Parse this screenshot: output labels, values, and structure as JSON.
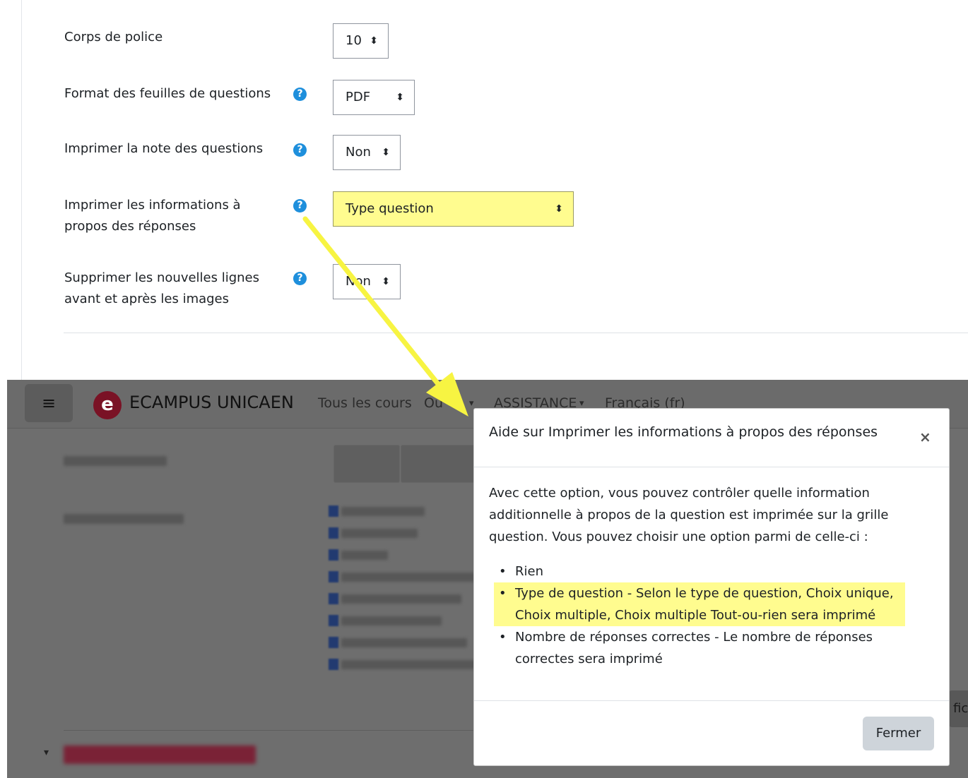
{
  "form": {
    "rows": [
      {
        "label": "Corps de police",
        "has_help": false,
        "value": "10"
      },
      {
        "label": "Format des feuilles de questions",
        "has_help": true,
        "value": "PDF"
      },
      {
        "label": "Imprimer la note des questions",
        "has_help": true,
        "value": "Non"
      },
      {
        "label_line1": "Imprimer les informations à",
        "label_line2": "propos des réponses",
        "has_help": true,
        "value": "Type question",
        "highlighted": true
      },
      {
        "label_line1": "Supprimer les nouvelles lignes",
        "label_line2": "avant et après les images",
        "has_help": true,
        "value": "Non"
      }
    ],
    "help_icon": "?"
  },
  "screenshot": {
    "menu_icon": "≡",
    "logo_letter": "e",
    "brand": "ECAMPUS UNICAEN",
    "nav": [
      "Tous les cours",
      "Ou",
      "ASSISTANCE",
      "Français (fr)"
    ],
    "nav_caret": "▾",
    "partial_button": "fich"
  },
  "modal": {
    "title": "Aide sur Imprimer les informations à propos des réponses",
    "close": "×",
    "intro_line1": "Avec cette option, vous pouvez contrôler quelle information",
    "intro_line2": "additionnelle à propos de la question est imprimée sur la grille",
    "intro_line3": "question. Vous pouvez choisir une option parmi de celle-ci :",
    "items": [
      {
        "line1": "Rien"
      },
      {
        "line1": "Type de question - Selon le type de question, Choix unique,",
        "line2": "Choix multiple, Choix multiple Tout-ou-rien sera imprimé"
      },
      {
        "line1": "Nombre de réponses correctes - Le nombre de réponses",
        "line2": "correctes sera imprimé"
      }
    ],
    "bullet": "•",
    "button": "Fermer"
  },
  "colors": {
    "highlight": "#fffc8f",
    "arrow": "#f7f442",
    "help_icon": "#1e8fdc",
    "brand_red": "#7a1225"
  }
}
